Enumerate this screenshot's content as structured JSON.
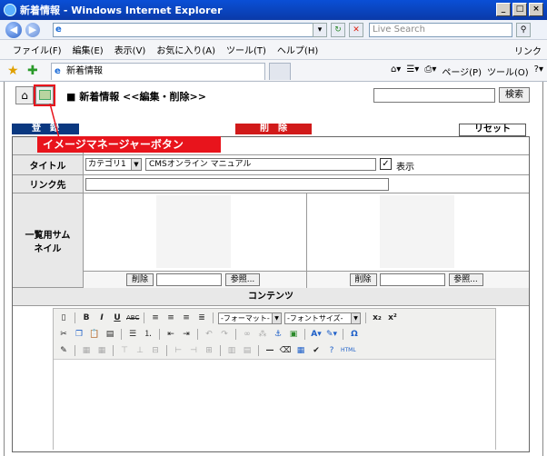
{
  "window": {
    "title": "新着情報 - Windows Internet Explorer"
  },
  "address_bar": {
    "url": "",
    "search_placeholder": "Live Search"
  },
  "menu": {
    "items": [
      "ファイル(F)",
      "編集(E)",
      "表示(V)",
      "お気に入り(A)",
      "ツール(T)",
      "ヘルプ(H)"
    ],
    "links_label": "リンク"
  },
  "tabs": {
    "active_label": "新着情報"
  },
  "ie_toolbar": {
    "page_label": "ページ(P)",
    "tools_label": "ツール(O)"
  },
  "header": {
    "page_title": "■ 新着情報 <<編集・削除>>",
    "search_button": "検索"
  },
  "actions": {
    "register": "登　録",
    "delete": "削　除",
    "reset": "リセット"
  },
  "callout": {
    "text": "イメージマネージャーボタン"
  },
  "form": {
    "title_label": "タイトル",
    "category_value": "カテゴリ1",
    "title_value": "CMSオンライン マニュアル",
    "display_checked": true,
    "display_label": "表示",
    "link_label": "リンク先",
    "link_value": "",
    "thumbnail_label": "一覧用サムネイル",
    "thumb_delete": "削除",
    "thumb_browse": "参照...",
    "contents_label": "コンテンツ"
  },
  "editor": {
    "format_dropdown": "-フォーマット-",
    "fontsize_dropdown": "-フォントサイズ-"
  },
  "colors": {
    "titlebar": "#0a4fd6",
    "register_bg": "#0a3880",
    "delete_bg": "#d11a1a",
    "callout_bg": "#e8141c"
  }
}
